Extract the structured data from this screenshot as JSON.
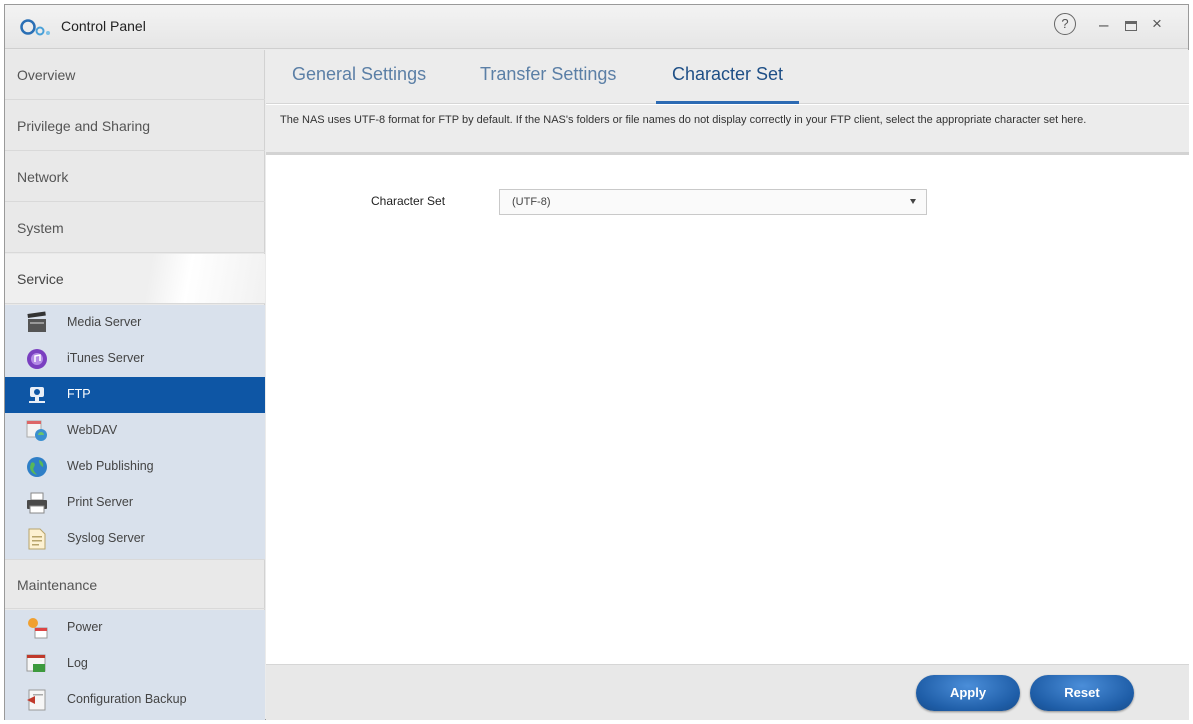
{
  "window": {
    "title": "Control Panel",
    "help_glyph": "?",
    "minimize_glyph": "–",
    "close_glyph": "×"
  },
  "sidebar": {
    "categories": [
      {
        "label": "Overview"
      },
      {
        "label": "Privilege and Sharing"
      },
      {
        "label": "Network"
      },
      {
        "label": "System"
      },
      {
        "label": "Service"
      },
      {
        "label": "Maintenance"
      }
    ],
    "service_items": [
      {
        "label": "Media Server",
        "icon": "media-server-icon"
      },
      {
        "label": "iTunes Server",
        "icon": "itunes-icon"
      },
      {
        "label": "FTP",
        "icon": "ftp-icon"
      },
      {
        "label": "WebDAV",
        "icon": "webdav-icon"
      },
      {
        "label": "Web Publishing",
        "icon": "globe-icon"
      },
      {
        "label": "Print Server",
        "icon": "printer-icon"
      },
      {
        "label": "Syslog Server",
        "icon": "syslog-icon"
      }
    ],
    "maintenance_items": [
      {
        "label": "Power",
        "icon": "power-icon"
      },
      {
        "label": "Log",
        "icon": "log-icon"
      },
      {
        "label": "Configuration Backup",
        "icon": "backup-icon"
      }
    ],
    "selected": "FTP"
  },
  "tabs": [
    {
      "label": "General Settings"
    },
    {
      "label": "Transfer Settings"
    },
    {
      "label": "Character Set"
    }
  ],
  "active_tab": "Character Set",
  "description": "The NAS uses UTF-8 format for FTP by default. If the NAS's folders or file names do not display correctly in your FTP client, select the appropriate character set here.",
  "form": {
    "charset_label": "Character Set",
    "charset_value": "(UTF-8)"
  },
  "footer": {
    "apply_label": "Apply",
    "reset_label": "Reset"
  },
  "colors": {
    "accent": "#0e56a5",
    "button": "#1f5ea8",
    "tab_text": "#5b7fa6"
  }
}
